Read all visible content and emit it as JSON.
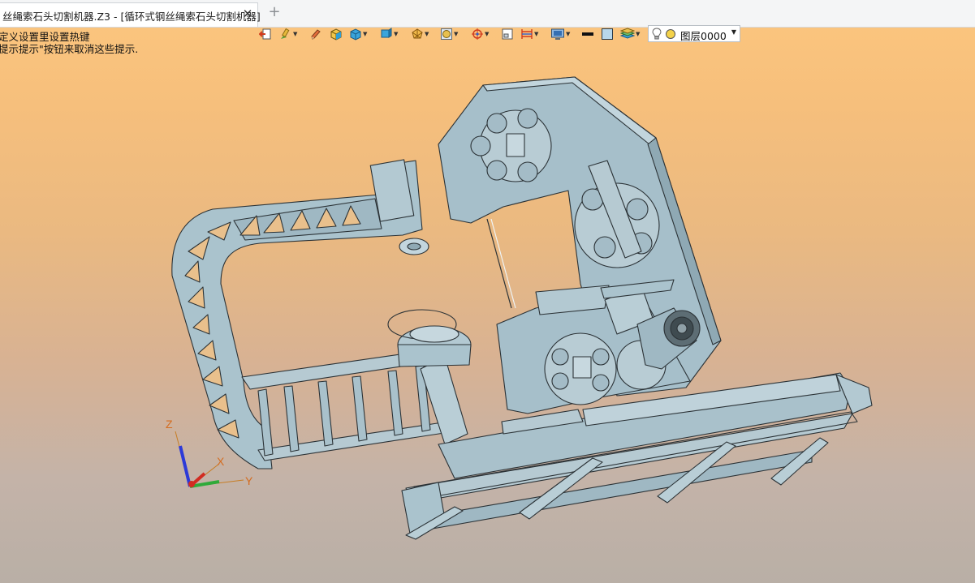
{
  "tab": {
    "title": "丝绳索石头切割机器.Z3 - [循环式钢丝绳索石头切割机器]",
    "close_glyph": "✕",
    "new_tab_glyph": "+"
  },
  "hint": {
    "line1": "定义设置里设置热键",
    "line2": "提示提示\"按钮来取消这些提示."
  },
  "toolbar": {
    "icons": [
      "exit-icon",
      "paint-brush-icon",
      "pencil-icon",
      "shaded-cube-icon",
      "cube-view-icon",
      "cube-view2-icon",
      "wireframe-icon",
      "render-mode-icon",
      "snap-target-icon",
      "new-window-icon",
      "dimension-icon",
      "display-panel-icon",
      "line-color-icon",
      "fill-color-icon",
      "layer-stack-icon"
    ],
    "layer_select": {
      "value": "图层0000",
      "bulb_color": "#f4d24a"
    }
  },
  "triad": {
    "z_label": "Z",
    "x_label": "X",
    "y_label": "Y"
  },
  "colors": {
    "model_fill": "#a9c1cb",
    "model_stroke": "#2b3236",
    "axis_z": "#2c3ad8",
    "axis_x": "#d12c22",
    "axis_y": "#2faa3a"
  }
}
